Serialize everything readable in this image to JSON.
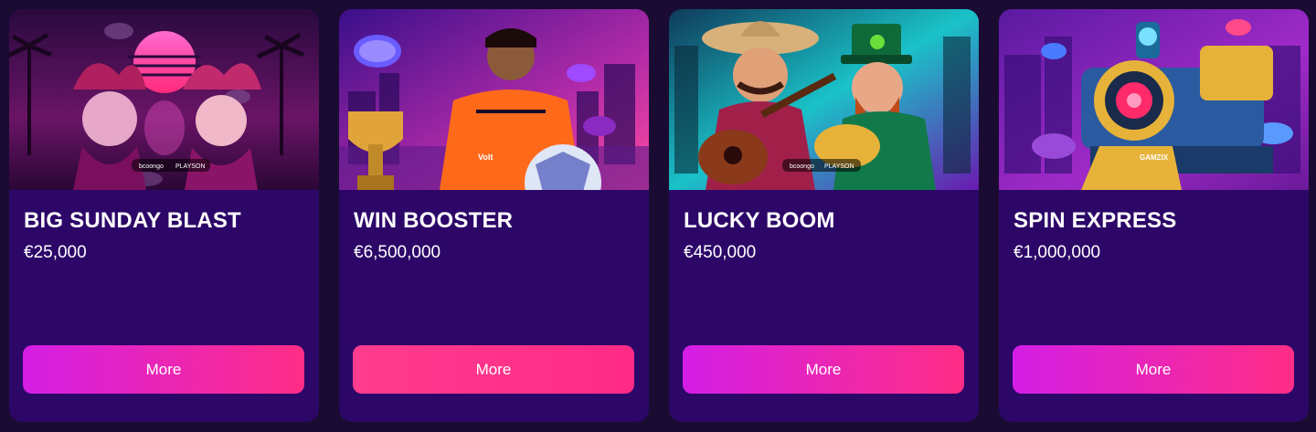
{
  "colors": {
    "page_bg": "#1a0b33",
    "card_bg": "#2c0768",
    "button_gradient_start": "#d41ee6",
    "button_gradient_end": "#ff2d86",
    "button_solid": "#ff3c8e"
  },
  "cards": [
    {
      "title": "BIG SUNDAY BLAST",
      "prize": "€25,000",
      "button": "More",
      "image": {
        "logo_left": "bcoongo",
        "logo_right": "PLAYSON"
      }
    },
    {
      "title": "WIN BOOSTER",
      "prize": "€6,500,000",
      "button": "More",
      "image": {
        "shirt_brand": "Volt"
      }
    },
    {
      "title": "LUCKY BOOM",
      "prize": "€450,000",
      "button": "More",
      "image": {
        "logo_left": "bcoongo",
        "logo_right": "PLAYSON"
      }
    },
    {
      "title": "SPIN EXPRESS",
      "prize": "€1,000,000",
      "button": "More",
      "image": {
        "logo": "GAMZIX"
      }
    }
  ]
}
